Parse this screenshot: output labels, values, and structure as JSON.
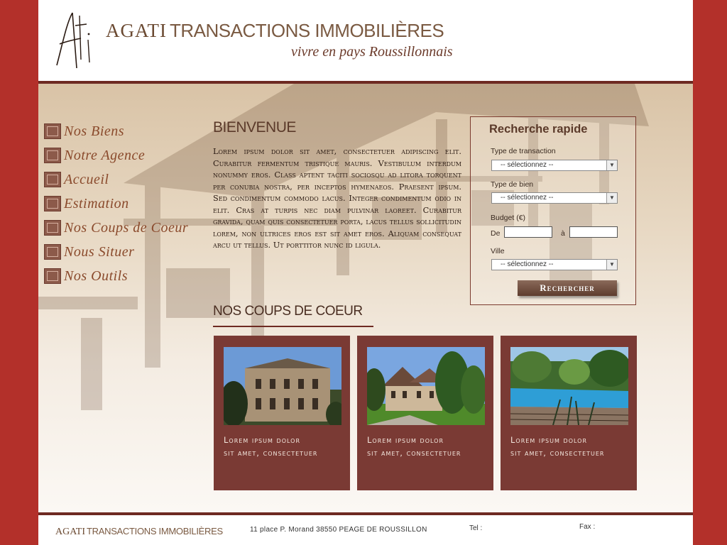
{
  "header": {
    "logo_mark": "Ati",
    "brand_primary": "AGATI",
    "brand_secondary": "TRANSACTIONS IMMOBILIÈRES",
    "tagline": "vivre en pays Roussillonnais"
  },
  "nav": {
    "items": [
      {
        "label": "Nos Biens"
      },
      {
        "label": "Notre Agence"
      },
      {
        "label": "Accueil"
      },
      {
        "label": "Estimation"
      },
      {
        "label": "Nos Coups de Coeur"
      },
      {
        "label": "Nous Situer"
      },
      {
        "label": "Nos Outils"
      }
    ]
  },
  "welcome": {
    "title": "BIENVENUE",
    "text": "Lorem ipsum dolor sit amet, consectetuer adipiscing elit. Curabitur fermentum tristique mauris. Vestibulum interdum nonummy eros. Class aptent taciti sociosqu ad litora torquent per conubia nostra, per inceptos hymenaeos. Praesent ipsum. Sed condimentum commodo lacus. Integer condimentum odio in elit. Cras at turpis nec diam pulvinar laoreet. Curabitur gravida, quam quis consectetuer porta, lacus tellus sollicitudin lorem, non ultrices eros est sit amet eros. Aliquam consequat arcu ut tellus. Ut porttitor nunc id ligula."
  },
  "search": {
    "title": "Recherche rapide",
    "transaction_label": "Type de transaction",
    "transaction_value": "-- sélectionnez --",
    "bien_label": "Type de bien",
    "bien_value": "-- sélectionnez --",
    "budget_label": "Budget (€)",
    "budget_from_label": "De",
    "budget_to_label": "à",
    "budget_from_value": "",
    "budget_to_value": "",
    "ville_label": "Ville",
    "ville_value": "-- sélectionnez --",
    "submit_label": "Rechercher"
  },
  "coups_de_coeur": {
    "title": "NOS COUPS DE COEUR",
    "cards": [
      {
        "line1": "Lorem ipsum dolor",
        "line2": "sit amet, consectetuer"
      },
      {
        "line1": "Lorem ipsum dolor",
        "line2": "sit amet, consectetuer"
      },
      {
        "line1": "Lorem ipsum dolor",
        "line2": "sit amet, consectetuer"
      }
    ]
  },
  "footer": {
    "brand_primary": "AGATI",
    "brand_secondary": "TRANSACTIONS IMMOBILIÈRES",
    "address": "11 place P. Morand  38550 PEAGE DE ROUSSILLON",
    "tel_label": "Tel :",
    "fax_label": "Fax :"
  },
  "colors": {
    "frame": "#b3302a",
    "accent_dark": "#6e2a22",
    "card_bg": "#7a3a34",
    "brand_text": "#6b4a32"
  }
}
